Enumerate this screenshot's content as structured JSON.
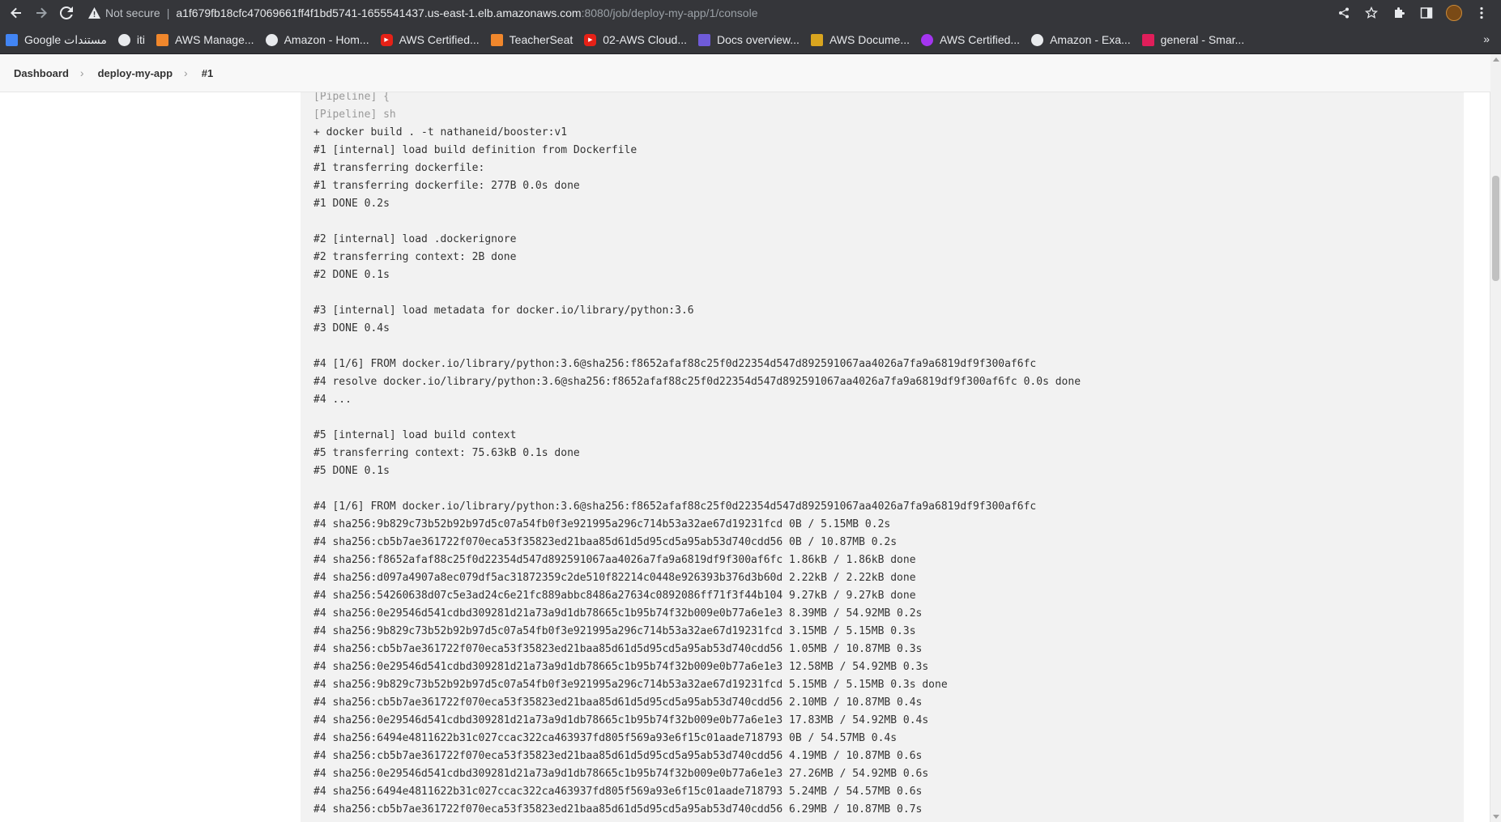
{
  "browser": {
    "not_secure": "Not secure",
    "separator": "|",
    "url_host": "a1f679fb18cfc47069661ff4f1bd5741-1655541437.us-east-1.elb.amazonaws.com",
    "url_path": ":8080/job/deploy-my-app/1/console"
  },
  "bookmarks": [
    {
      "label": "Google مستندات",
      "icon": "google-docs-icon",
      "color": "#4285f4"
    },
    {
      "label": "iti",
      "icon": "globe-icon",
      "color": "#5f6368"
    },
    {
      "label": "AWS Manage...",
      "icon": "aws-cube-icon",
      "color": "#f0872c"
    },
    {
      "label": "Amazon - Hom...",
      "icon": "globe-icon",
      "color": "#5f6368"
    },
    {
      "label": "AWS Certified...",
      "icon": "youtube-icon",
      "color": "#e62117"
    },
    {
      "label": "TeacherSeat",
      "icon": "teacherseat-icon",
      "color": "#f0872c"
    },
    {
      "label": "02-AWS Cloud...",
      "icon": "youtube-icon",
      "color": "#e62117"
    },
    {
      "label": "Docs overview...",
      "icon": "docs-icon",
      "color": "#6f5bd9"
    },
    {
      "label": "AWS Docume...",
      "icon": "aws-box-icon",
      "color": "#d9a51f"
    },
    {
      "label": "AWS Certified...",
      "icon": "udemy-icon",
      "color": "#a435f0"
    },
    {
      "label": "Amazon - Exa...",
      "icon": "globe-icon",
      "color": "#5f6368"
    },
    {
      "label": "general - Smar...",
      "icon": "slack-icon",
      "color": "#e01e5a"
    }
  ],
  "breadcrumb": {
    "dashboard": "Dashboard",
    "job": "deploy-my-app",
    "build": "#1"
  },
  "console": {
    "lines": [
      {
        "text": "[Pipeline] {",
        "kind": "pipeline"
      },
      {
        "text": "[Pipeline] sh",
        "kind": "pipeline"
      },
      {
        "text": "+ docker build . -t nathaneid/booster:v1",
        "kind": "out"
      },
      {
        "text": "#1 [internal] load build definition from Dockerfile",
        "kind": "out"
      },
      {
        "text": "#1 transferring dockerfile:",
        "kind": "out"
      },
      {
        "text": "#1 transferring dockerfile: 277B 0.0s done",
        "kind": "out"
      },
      {
        "text": "#1 DONE 0.2s",
        "kind": "out"
      },
      {
        "text": "",
        "kind": "out"
      },
      {
        "text": "#2 [internal] load .dockerignore",
        "kind": "out"
      },
      {
        "text": "#2 transferring context: 2B done",
        "kind": "out"
      },
      {
        "text": "#2 DONE 0.1s",
        "kind": "out"
      },
      {
        "text": "",
        "kind": "out"
      },
      {
        "text": "#3 [internal] load metadata for docker.io/library/python:3.6",
        "kind": "out"
      },
      {
        "text": "#3 DONE 0.4s",
        "kind": "out"
      },
      {
        "text": "",
        "kind": "out"
      },
      {
        "text": "#4 [1/6] FROM docker.io/library/python:3.6@sha256:f8652afaf88c25f0d22354d547d892591067aa4026a7fa9a6819df9f300af6fc",
        "kind": "out"
      },
      {
        "text": "#4 resolve docker.io/library/python:3.6@sha256:f8652afaf88c25f0d22354d547d892591067aa4026a7fa9a6819df9f300af6fc 0.0s done",
        "kind": "out"
      },
      {
        "text": "#4 ...",
        "kind": "out"
      },
      {
        "text": "",
        "kind": "out"
      },
      {
        "text": "#5 [internal] load build context",
        "kind": "out"
      },
      {
        "text": "#5 transferring context: 75.63kB 0.1s done",
        "kind": "out"
      },
      {
        "text": "#5 DONE 0.1s",
        "kind": "out"
      },
      {
        "text": "",
        "kind": "out"
      },
      {
        "text": "#4 [1/6] FROM docker.io/library/python:3.6@sha256:f8652afaf88c25f0d22354d547d892591067aa4026a7fa9a6819df9f300af6fc",
        "kind": "out"
      },
      {
        "text": "#4 sha256:9b829c73b52b92b97d5c07a54fb0f3e921995a296c714b53a32ae67d19231fcd 0B / 5.15MB 0.2s",
        "kind": "out"
      },
      {
        "text": "#4 sha256:cb5b7ae361722f070eca53f35823ed21baa85d61d5d95cd5a95ab53d740cdd56 0B / 10.87MB 0.2s",
        "kind": "out"
      },
      {
        "text": "#4 sha256:f8652afaf88c25f0d22354d547d892591067aa4026a7fa9a6819df9f300af6fc 1.86kB / 1.86kB done",
        "kind": "out"
      },
      {
        "text": "#4 sha256:d097a4907a8ec079df5ac31872359c2de510f82214c0448e926393b376d3b60d 2.22kB / 2.22kB done",
        "kind": "out"
      },
      {
        "text": "#4 sha256:54260638d07c5e3ad24c6e21fc889abbc8486a27634c0892086ff71f3f44b104 9.27kB / 9.27kB done",
        "kind": "out"
      },
      {
        "text": "#4 sha256:0e29546d541cdbd309281d21a73a9d1db78665c1b95b74f32b009e0b77a6e1e3 8.39MB / 54.92MB 0.2s",
        "kind": "out"
      },
      {
        "text": "#4 sha256:9b829c73b52b92b97d5c07a54fb0f3e921995a296c714b53a32ae67d19231fcd 3.15MB / 5.15MB 0.3s",
        "kind": "out"
      },
      {
        "text": "#4 sha256:cb5b7ae361722f070eca53f35823ed21baa85d61d5d95cd5a95ab53d740cdd56 1.05MB / 10.87MB 0.3s",
        "kind": "out"
      },
      {
        "text": "#4 sha256:0e29546d541cdbd309281d21a73a9d1db78665c1b95b74f32b009e0b77a6e1e3 12.58MB / 54.92MB 0.3s",
        "kind": "out"
      },
      {
        "text": "#4 sha256:9b829c73b52b92b97d5c07a54fb0f3e921995a296c714b53a32ae67d19231fcd 5.15MB / 5.15MB 0.3s done",
        "kind": "out"
      },
      {
        "text": "#4 sha256:cb5b7ae361722f070eca53f35823ed21baa85d61d5d95cd5a95ab53d740cdd56 2.10MB / 10.87MB 0.4s",
        "kind": "out"
      },
      {
        "text": "#4 sha256:0e29546d541cdbd309281d21a73a9d1db78665c1b95b74f32b009e0b77a6e1e3 17.83MB / 54.92MB 0.4s",
        "kind": "out"
      },
      {
        "text": "#4 sha256:6494e4811622b31c027ccac322ca463937fd805f569a93e6f15c01aade718793 0B / 54.57MB 0.4s",
        "kind": "out"
      },
      {
        "text": "#4 sha256:cb5b7ae361722f070eca53f35823ed21baa85d61d5d95cd5a95ab53d740cdd56 4.19MB / 10.87MB 0.6s",
        "kind": "out"
      },
      {
        "text": "#4 sha256:0e29546d541cdbd309281d21a73a9d1db78665c1b95b74f32b009e0b77a6e1e3 27.26MB / 54.92MB 0.6s",
        "kind": "out"
      },
      {
        "text": "#4 sha256:6494e4811622b31c027ccac322ca463937fd805f569a93e6f15c01aade718793 5.24MB / 54.57MB 0.6s",
        "kind": "out"
      },
      {
        "text": "#4 sha256:cb5b7ae361722f070eca53f35823ed21baa85d61d5d95cd5a95ab53d740cdd56 6.29MB / 10.87MB 0.7s",
        "kind": "out"
      }
    ]
  }
}
